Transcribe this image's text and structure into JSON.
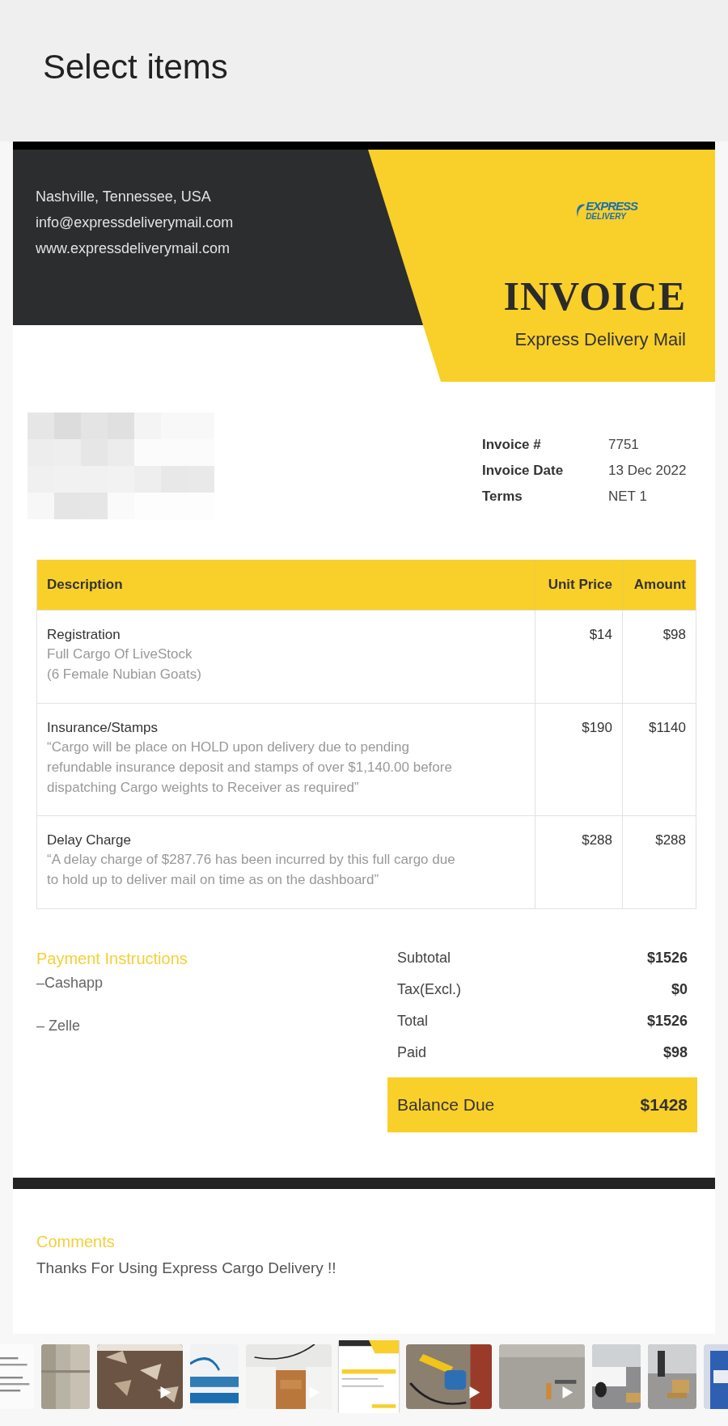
{
  "screen_title": "Select items",
  "invoice": {
    "contact_lines": [
      "Nashville, Tennessee, USA",
      "info@expressdeliverymail.com",
      "www.expressdeliverymail.com"
    ],
    "logo": {
      "line1": "EXPRESS",
      "line2": "DELIVERY"
    },
    "title": "INVOICE",
    "company": "Express Delivery Mail",
    "meta": [
      {
        "label": "Invoice #",
        "value": "7751"
      },
      {
        "label": "Invoice Date",
        "value": "13 Dec 2022"
      },
      {
        "label": "Terms",
        "value": "NET 1"
      }
    ],
    "table": {
      "columns": [
        "Description",
        "Unit Price",
        "Amount"
      ],
      "rows": [
        {
          "title": "Registration",
          "details": [
            "Full Cargo Of LiveStock",
            "(6 Female Nubian Goats)"
          ],
          "unit_price": "$14",
          "amount": "$98"
        },
        {
          "title": "Insurance/Stamps",
          "details": [
            "“Cargo will be place on HOLD upon delivery due to pending",
            "refundable insurance deposit and stamps of over $1,140.00 before",
            "dispatching Cargo weights to Receiver as required”"
          ],
          "unit_price": "$190",
          "amount": "$1140"
        },
        {
          "title": "Delay Charge",
          "details": [
            "“A delay charge of $287.76 has been incurred by this full cargo due",
            "to hold up to deliver mail on time as on the dashboard”"
          ],
          "unit_price": "$288",
          "amount": "$288"
        }
      ]
    },
    "payment": {
      "heading": "Payment Instructions",
      "methods": [
        "–Cashapp",
        "– Zelle"
      ]
    },
    "totals": [
      {
        "label": "Subtotal",
        "value": "$1526",
        "kind": "plain"
      },
      {
        "label": "Tax(Excl.)",
        "value": "$0",
        "kind": "plain"
      },
      {
        "label": "Total",
        "value": "$1526",
        "kind": "plain"
      },
      {
        "label": "Paid",
        "value": "$98",
        "kind": "plain"
      },
      {
        "label": "Balance Due",
        "value": "$1428",
        "kind": "due"
      }
    ],
    "comments": {
      "heading": "Comments",
      "text": "Thanks For Using Express Cargo Delivery !!"
    }
  },
  "thumbnails": [
    {
      "kind": "picture",
      "video": false,
      "selected": false
    },
    {
      "kind": "picture",
      "video": false,
      "selected": false
    },
    {
      "kind": "picture",
      "video": true,
      "selected": false
    },
    {
      "kind": "picture",
      "video": false,
      "selected": false
    },
    {
      "kind": "picture",
      "video": true,
      "selected": false
    },
    {
      "kind": "picture",
      "video": false,
      "selected": true
    },
    {
      "kind": "picture",
      "video": true,
      "selected": false
    },
    {
      "kind": "picture",
      "video": true,
      "selected": false
    },
    {
      "kind": "picture",
      "video": false,
      "selected": false
    },
    {
      "kind": "picture",
      "video": false,
      "selected": false
    },
    {
      "kind": "picture",
      "video": false,
      "selected": false
    }
  ]
}
